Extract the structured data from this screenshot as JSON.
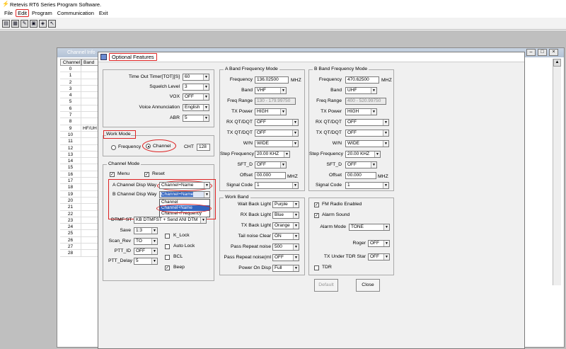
{
  "app": {
    "title": "Retevis RT6 Series Program Software."
  },
  "menu": [
    "File",
    "Edit",
    "Program",
    "Communication",
    "Exit"
  ],
  "toolbar": {
    "buttons": [
      "new-icon",
      "open-icon",
      "save-icon",
      "read-radio-icon",
      "write-radio-icon",
      "help-icon"
    ]
  },
  "channel_window": {
    "title": "Channel Info",
    "col_channel": "Channel",
    "col_band": "Band",
    "rows": [
      {
        "n": "0",
        "b": ""
      },
      {
        "n": "1",
        "b": ""
      },
      {
        "n": "2",
        "b": ""
      },
      {
        "n": "3",
        "b": ""
      },
      {
        "n": "4",
        "b": ""
      },
      {
        "n": "5",
        "b": ""
      },
      {
        "n": "6",
        "b": ""
      },
      {
        "n": "7",
        "b": ""
      },
      {
        "n": "8",
        "b": ""
      },
      {
        "n": "9",
        "b": "HF/UH"
      },
      {
        "n": "10",
        "b": ""
      },
      {
        "n": "11",
        "b": ""
      },
      {
        "n": "12",
        "b": ""
      },
      {
        "n": "13",
        "b": ""
      },
      {
        "n": "14",
        "b": ""
      },
      {
        "n": "15",
        "b": ""
      },
      {
        "n": "16",
        "b": ""
      },
      {
        "n": "17",
        "b": ""
      },
      {
        "n": "18",
        "b": ""
      },
      {
        "n": "19",
        "b": ""
      },
      {
        "n": "20",
        "b": ""
      },
      {
        "n": "21",
        "b": ""
      },
      {
        "n": "22",
        "b": ""
      },
      {
        "n": "23",
        "b": ""
      },
      {
        "n": "24",
        "b": ""
      },
      {
        "n": "25",
        "b": ""
      },
      {
        "n": "26",
        "b": ""
      },
      {
        "n": "27",
        "b": ""
      },
      {
        "n": "28",
        "b": ""
      }
    ]
  },
  "dialog": {
    "title": "Optional Features",
    "general": {
      "tot_label": "Time Out Timer[TOT][S]",
      "tot_value": "60",
      "squelch_label": "Squelch Level",
      "squelch_value": "3",
      "vox_label": "VOX",
      "vox_value": "OFF",
      "voice_label": "Voice Annunciation",
      "voice_value": "English",
      "abr_label": "ABR",
      "abr_value": "5"
    },
    "work_mode": {
      "group": "Work Mode",
      "frequency": "Frequency",
      "channel": "Channel",
      "cht_label": "CHT",
      "cht_value": "128"
    },
    "channel_mode": {
      "group": "Channel Mode",
      "menu": "Menu",
      "reset": "Reset",
      "a_disp_label": "A Channel Disp Way",
      "a_disp_value": "Channel+Name",
      "b_disp_label": "B Channel Disp Way",
      "b_disp_value": "Channel+Name",
      "options": [
        "Channel",
        "Channel+Name",
        "Channel+Frequency"
      ]
    },
    "misc": {
      "dtmf_label": "DTMF ST",
      "dtmf_value": "KB DTMFST + Send ANI DTM",
      "save_label": "Save",
      "save_value": "1:3",
      "scan_label": "Scan_Rev",
      "scan_value": "TO",
      "ptt_id_label": "PTT_ID",
      "ptt_id_value": "OFF",
      "ptt_delay_label": "PTT_Delay",
      "ptt_delay_value": "5",
      "k_lock": "K_Lock",
      "auto_lock": "Auto Lock",
      "bcl": "BCL",
      "beep": "Beep"
    },
    "a_band": {
      "group": "A Band Frequency Mode",
      "frequency_label": "Frequency",
      "frequency_value": "136.02500",
      "unit": "MHZ",
      "band_label": "Band",
      "band_value": "VHF",
      "range_label": "Freq Range",
      "range_value": "130 - 179.99750",
      "power_label": "TX Power",
      "power_value": "HIGH",
      "rx_label": "RX QT/DQT",
      "rx_value": "OFF",
      "tx_label": "TX QT/DQT",
      "tx_value": "OFF",
      "wn_label": "W/N",
      "wn_value": "WIDE",
      "step_label": "Step Frequency",
      "step_value": "20.00 KHZ",
      "sft_label": "SFT_D",
      "sft_value": "OFF",
      "offset_label": "Offset",
      "offset_value": "00.000",
      "offset_unit": "MHZ",
      "signal_label": "Signal Code",
      "signal_value": "1"
    },
    "b_band": {
      "group": "B Band Frequency Mode",
      "frequency_label": "Frequency",
      "frequency_value": "470.62500",
      "unit": "MHZ",
      "band_label": "Band",
      "band_value": "UHF",
      "range_label": "Freq Range",
      "range_value": "400 - 520.99750",
      "power_label": "TX Power",
      "power_value": "HIGH",
      "rx_label": "RX QT/DQT",
      "rx_value": "OFF",
      "tx_label": "TX QT/DQT",
      "tx_value": "OFF",
      "wn_label": "W/N",
      "wn_value": "WIDE",
      "step_label": "Step Frequency",
      "step_value": "20.00 KHZ",
      "sft_label": "SFT_D",
      "sft_value": "OFF",
      "offset_label": "Offset",
      "offset_value": "00.000",
      "offset_unit": "MHZ",
      "signal_label": "Signal Code",
      "signal_value": "1"
    },
    "work_band": {
      "group": "Work Band",
      "wait_label": "Wait Back Light",
      "wait_value": "Purple",
      "rx_light_label": "RX Back Light",
      "rx_light_value": "Blue",
      "tx_light_label": "TX Back Light",
      "tx_light_value": "Orange",
      "tail_label": "Tail noise Clear",
      "tail_value": "ON",
      "pass_label": "Pass Repeat noise",
      "pass_value": "500",
      "pass2_label": "Pass Repeat noise(ml",
      "pass2_value": "OFF",
      "power_on_label": "Power On Disp",
      "power_on_value": "Full"
    },
    "extras": {
      "fm_radio": "FM Radio Enabled",
      "alarm_sound": "Alarm Sound",
      "alarm_mode_label": "Alarm Mode",
      "alarm_mode_value": "TONE",
      "roger_label": "Roger",
      "roger_value": "OFF",
      "tdr_star_label": "TX Under TDR Star",
      "tdr_star_value": "OFF",
      "tdr": "TDR"
    },
    "default_button": "Default",
    "close_button": "Close"
  },
  "colors": {
    "highlight": "#d22222",
    "selection": "#3466c0"
  }
}
